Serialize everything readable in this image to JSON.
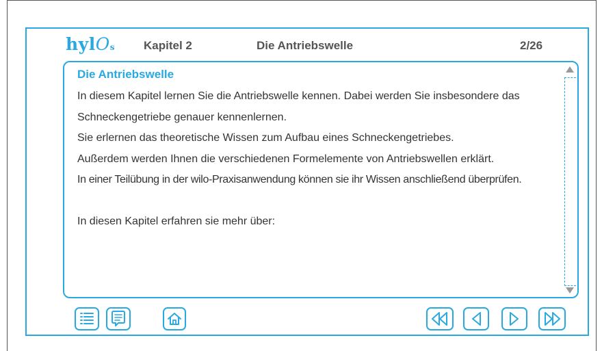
{
  "app": {
    "logo_main": "hyl",
    "logo_o": "O",
    "logo_dot": "s",
    "chapter": "Kapitel 2",
    "title": "Die Antriebswelle",
    "pages": "2/26"
  },
  "content": {
    "heading": "Die Antriebswelle",
    "paragraphs": [
      "In diesem Kapitel lernen Sie die Antriebswelle kennen.  Dabei werden Sie insbesondere das Schneckengetriebe genauer kennenlernen.",
      "Sie erlernen das theoretische Wissen zum Aufbau eines Schneckengetriebes.",
      "Außerdem werden Ihnen die verschiedenen Formelemente von Antriebswellen erklärt.",
      "In einer Teilübung in der wilo-Praxisanwendung können sie ihr Wissen anschließend überprüfen.",
      "",
      "In diesen Kapitel erfahren sie mehr über:"
    ]
  },
  "colors": {
    "accent": "#29a9e1",
    "text": "#333333",
    "header_text": "#555555"
  },
  "toolbar": {
    "icons": [
      "list-icon",
      "notes-icon",
      "home-icon",
      "first-page-icon",
      "previous-page-icon",
      "next-page-icon",
      "last-page-icon"
    ]
  }
}
